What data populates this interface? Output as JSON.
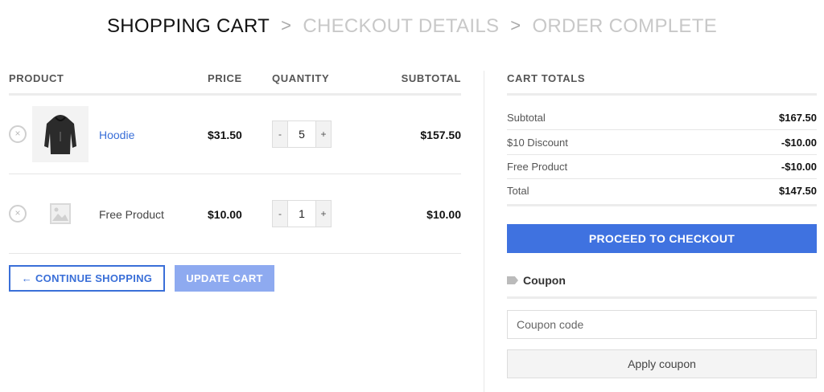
{
  "breadcrumb": {
    "step1": "SHOPPING CART",
    "step2": "CHECKOUT DETAILS",
    "step3": "ORDER COMPLETE",
    "separator": ">"
  },
  "cart": {
    "headers": {
      "product": "PRODUCT",
      "price": "PRICE",
      "quantity": "QUANTITY",
      "subtotal": "SUBTOTAL"
    },
    "items": [
      {
        "name": "Hoodie",
        "price": "$31.50",
        "quantity": "5",
        "subtotal": "$157.50",
        "thumbnail_icon": "hoodie-image"
      },
      {
        "name": "Free Product",
        "price": "$10.00",
        "quantity": "1",
        "subtotal": "$10.00",
        "thumbnail_icon": "placeholder-image-icon"
      }
    ],
    "remove_symbol": "×",
    "minus": "-",
    "plus": "+",
    "continue_label": "← CONTINUE SHOPPING",
    "update_label": "UPDATE CART"
  },
  "totals": {
    "title": "CART TOTALS",
    "rows": [
      {
        "label": "Subtotal",
        "amount": "$167.50"
      },
      {
        "label": "$10 Discount",
        "amount": "-$10.00"
      },
      {
        "label": "Free Product",
        "amount": "-$10.00"
      },
      {
        "label": "Total",
        "amount": "$147.50"
      }
    ],
    "checkout_label": "PROCEED TO CHECKOUT"
  },
  "coupon": {
    "heading": "Coupon",
    "placeholder": "Coupon code",
    "apply_label": "Apply coupon"
  },
  "colors": {
    "accent": "#3f72e0",
    "link": "#3a6fd8",
    "update_button": "#8eaaf0"
  }
}
